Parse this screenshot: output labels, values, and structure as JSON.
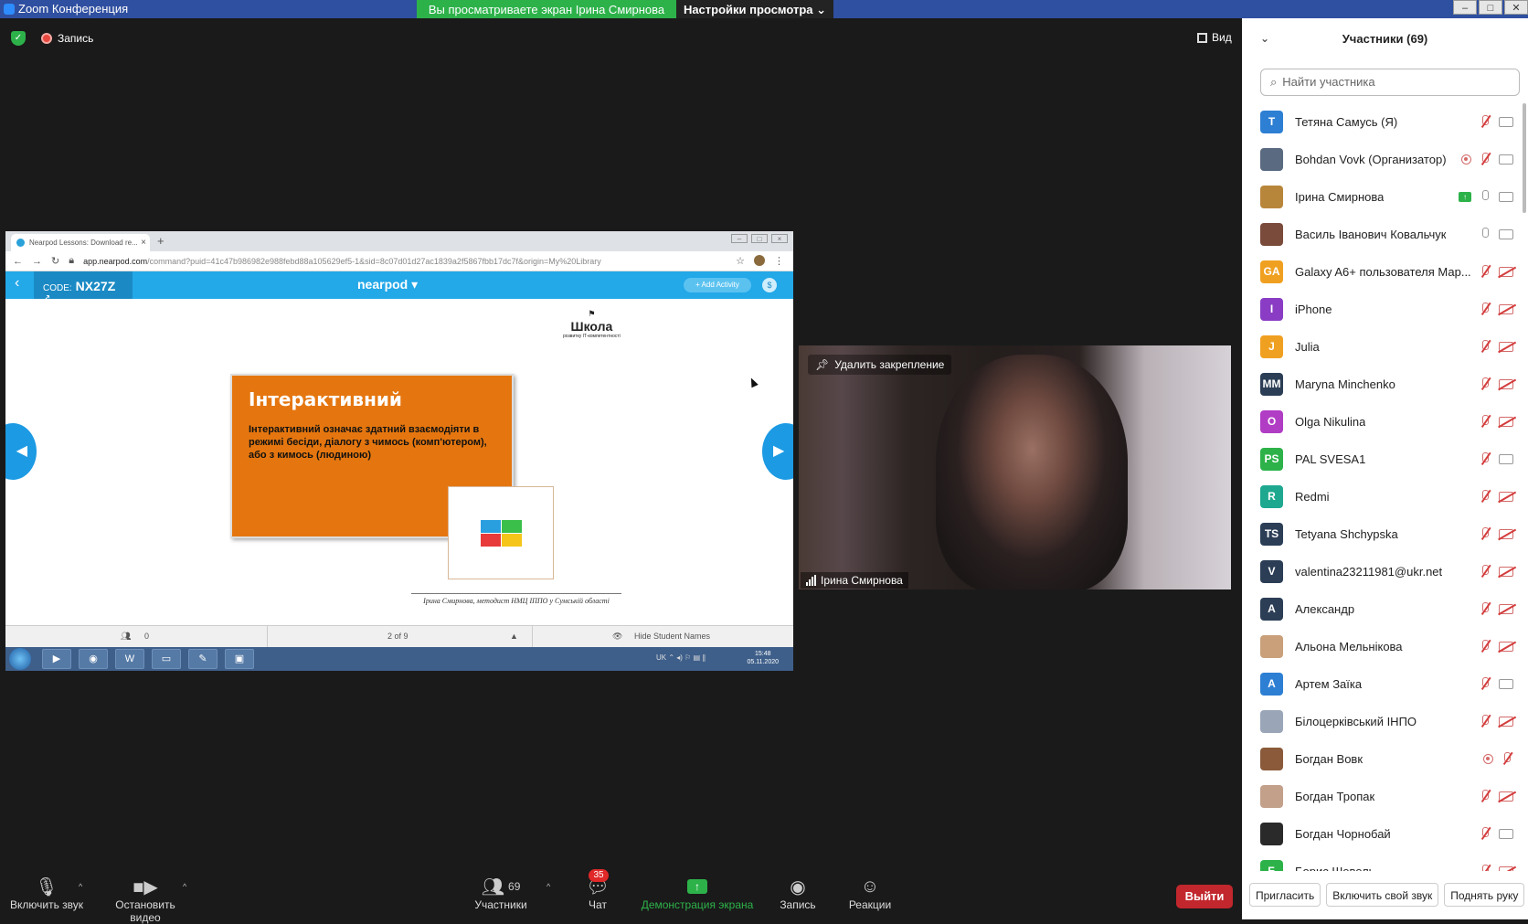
{
  "window": {
    "title": "Zoom Конференция",
    "share_banner": "Вы просматриваете экран Ірина Смирнова",
    "view_options": "Настройки просмотра ⌄"
  },
  "topbar": {
    "record_label": "Запись",
    "view_label": "Вид"
  },
  "shared": {
    "tab_title": "Nearpod Lessons: Download re...",
    "url_domain": "app.nearpod.com",
    "url_rest": "/command?puid=41c47b986982e988febd88a105629ef5-1&sid=8c07d01d27ac1839a2f5867fbb17dc7f&origin=My%20Library",
    "code_label": "CODE:",
    "code": "NX27Z",
    "logo": "nearpod ▾",
    "add_activity": "+ Add Activity",
    "school": "Школа",
    "school_sub": "розвитку IT-компетентності",
    "card_title": "Інтерактивний",
    "card_text": "Інтерактивний означає здатний взаємодіяти в режимі бесіди, діалогу з чимось (комп'ютером), або з кимось (людиною)",
    "signature": "Ірина Смирнова, методист НМЦ ІППО у Сумській області",
    "students": "0",
    "page": "2 of 9",
    "hide_names": "Hide Student Names",
    "clock_time": "15:48",
    "clock_date": "05.11.2020",
    "tray_lang": "UK"
  },
  "video": {
    "unpin": "Удалить закрепление",
    "name": "Ірина Смирнова"
  },
  "toolbar": {
    "mute": "Включить звук",
    "video": "Остановить видео",
    "participants": "Участники",
    "participants_count": "69",
    "chat": "Чат",
    "chat_badge": "35",
    "share": "Демонстрация экрана",
    "record": "Запись",
    "reactions": "Реакции",
    "leave": "Выйти"
  },
  "panel": {
    "title": "Участники (69)",
    "search_placeholder": "Найти участника",
    "invite": "Пригласить",
    "unmute_me": "Включить свой звук",
    "raise_hand": "Поднять руку"
  },
  "participants": [
    {
      "initials": "T",
      "name": "Тетяна Самусь (Я)",
      "color": "#2d7fd3",
      "mic": "off",
      "cam": "on"
    },
    {
      "initials": "",
      "name": "Bohdan Vovk (Организатор)",
      "color": "#5a6a80",
      "mic": "off",
      "cam": "on",
      "rec": true
    },
    {
      "initials": "",
      "name": "Ірина Смирнова",
      "color": "#b8863a",
      "mic": "on",
      "cam": "on",
      "sharing": true
    },
    {
      "initials": "",
      "name": "Василь Іванович Ковальчук",
      "color": "#7a4a3a",
      "mic": "on",
      "cam": "on"
    },
    {
      "initials": "GA",
      "name": "Galaxy A6+ пользователя Мар...",
      "color": "#f0a020",
      "mic": "off",
      "cam": "off"
    },
    {
      "initials": "I",
      "name": "iPhone",
      "color": "#8a3dc4",
      "mic": "off",
      "cam": "off"
    },
    {
      "initials": "J",
      "name": "Julia",
      "color": "#f0a020",
      "mic": "off",
      "cam": "off"
    },
    {
      "initials": "MM",
      "name": "Maryna Minchenko",
      "color": "#2c3e56",
      "mic": "off",
      "cam": "off"
    },
    {
      "initials": "O",
      "name": "Olga Nikulina",
      "color": "#b03dc4",
      "mic": "off",
      "cam": "off"
    },
    {
      "initials": "PS",
      "name": "PAL SVESA1",
      "color": "#2db24a",
      "mic": "off",
      "cam": "on"
    },
    {
      "initials": "R",
      "name": "Redmi",
      "color": "#1fa890",
      "mic": "off",
      "cam": "off"
    },
    {
      "initials": "TS",
      "name": "Tetyana Shchypska",
      "color": "#2c3e56",
      "mic": "off",
      "cam": "off"
    },
    {
      "initials": "V",
      "name": "valentina23211981@ukr.net",
      "color": "#2c3e56",
      "mic": "off",
      "cam": "off"
    },
    {
      "initials": "А",
      "name": "Александр",
      "color": "#2c3e56",
      "mic": "off",
      "cam": "off"
    },
    {
      "initials": "",
      "name": "Альона Мельнікова",
      "color": "#c9a07a",
      "mic": "off",
      "cam": "off"
    },
    {
      "initials": "А",
      "name": "Артем Заїка",
      "color": "#2d7fd3",
      "mic": "off",
      "cam": "on"
    },
    {
      "initials": "",
      "name": "Білоцерківський ІНПО",
      "color": "#9aa6b8",
      "mic": "off",
      "cam": "off"
    },
    {
      "initials": "",
      "name": "Богдан Вовк",
      "color": "#8a5a3a",
      "mic": "off",
      "cam": "none",
      "rec": true
    },
    {
      "initials": "",
      "name": "Богдан Тропак",
      "color": "#c2a08a",
      "mic": "off",
      "cam": "off"
    },
    {
      "initials": "",
      "name": "Богдан Чорнобай",
      "color": "#2a2a2a",
      "mic": "off",
      "cam": "on"
    },
    {
      "initials": "Б",
      "name": "Борис Шевель",
      "color": "#2db24a",
      "mic": "off",
      "cam": "off"
    }
  ]
}
